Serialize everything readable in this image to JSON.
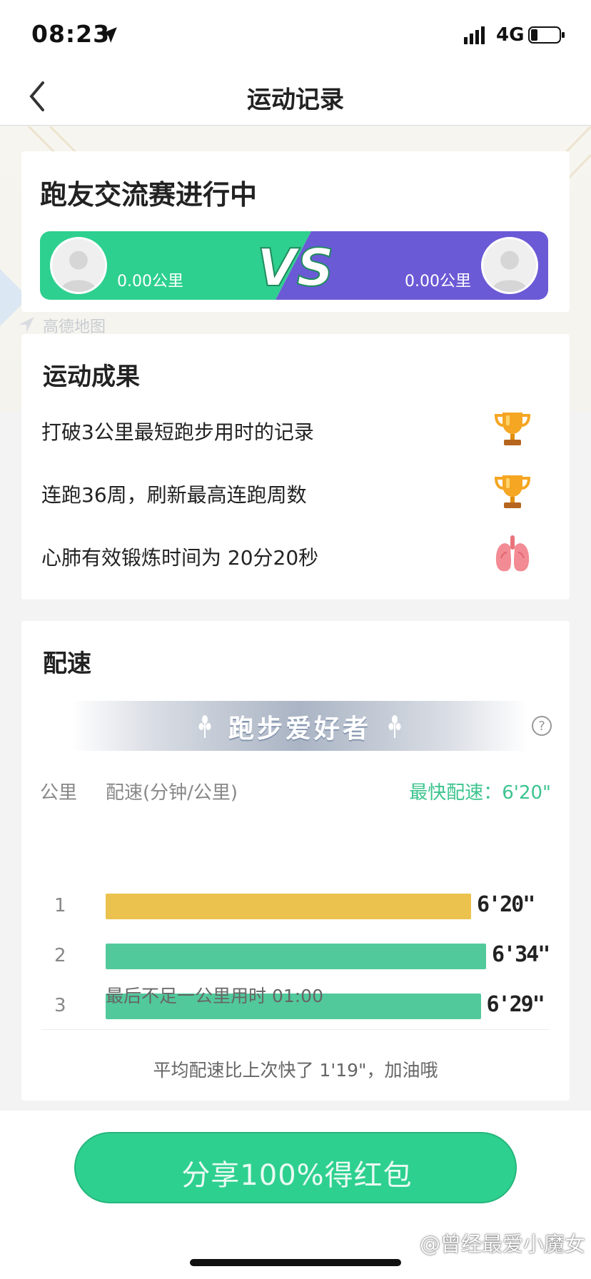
{
  "status_bar": {
    "time": "08:23",
    "network": "4G",
    "icons": [
      "location-arrow-icon",
      "signal-icon",
      "battery-icon"
    ]
  },
  "nav": {
    "title": "运动记录",
    "back_icon": "chevron-left-icon"
  },
  "map": {
    "label": "高德地图"
  },
  "race": {
    "title": "跑友交流赛进行中",
    "left_distance": "0.00公里",
    "right_distance": "0.00公里",
    "vs_text": "VS",
    "colors": {
      "left": "#2ed08f",
      "right": "#6a5ad6"
    }
  },
  "results": {
    "title": "运动成果",
    "items": [
      {
        "text": "打破3公里最短跑步用时的记录",
        "icon": "trophy-icon"
      },
      {
        "text": "连跑36周，刷新最高连跑周数",
        "icon": "trophy-icon"
      },
      {
        "text": "心肺有效锻炼时间为 20分20秒",
        "icon": "lungs-icon"
      }
    ]
  },
  "pace": {
    "title": "配速",
    "badge": "跑步爱好者",
    "col_km": "公里",
    "col_pace": "配速(分钟/公里)",
    "fastest": "最快配速：6'20\"",
    "rows": [
      {
        "km": "1",
        "pace": "6'20\"",
        "seconds": 380,
        "color": "#ecc24f"
      },
      {
        "km": "2",
        "pace": "6'34\"",
        "seconds": 394,
        "color": "#52c99b"
      },
      {
        "km": "3",
        "pace": "6'29\"",
        "seconds": 389,
        "color": "#52c99b"
      }
    ],
    "last_km_note": "最后不足一公里用时 01:00",
    "avg_note": "平均配速比上次快了 1'19\"，加油哦"
  },
  "share": {
    "label": "分享100%得红包"
  },
  "watermark": "@曾经最爱小魔女",
  "colors": {
    "accent": "#2ed08f",
    "fastest": "#3cc48e"
  }
}
